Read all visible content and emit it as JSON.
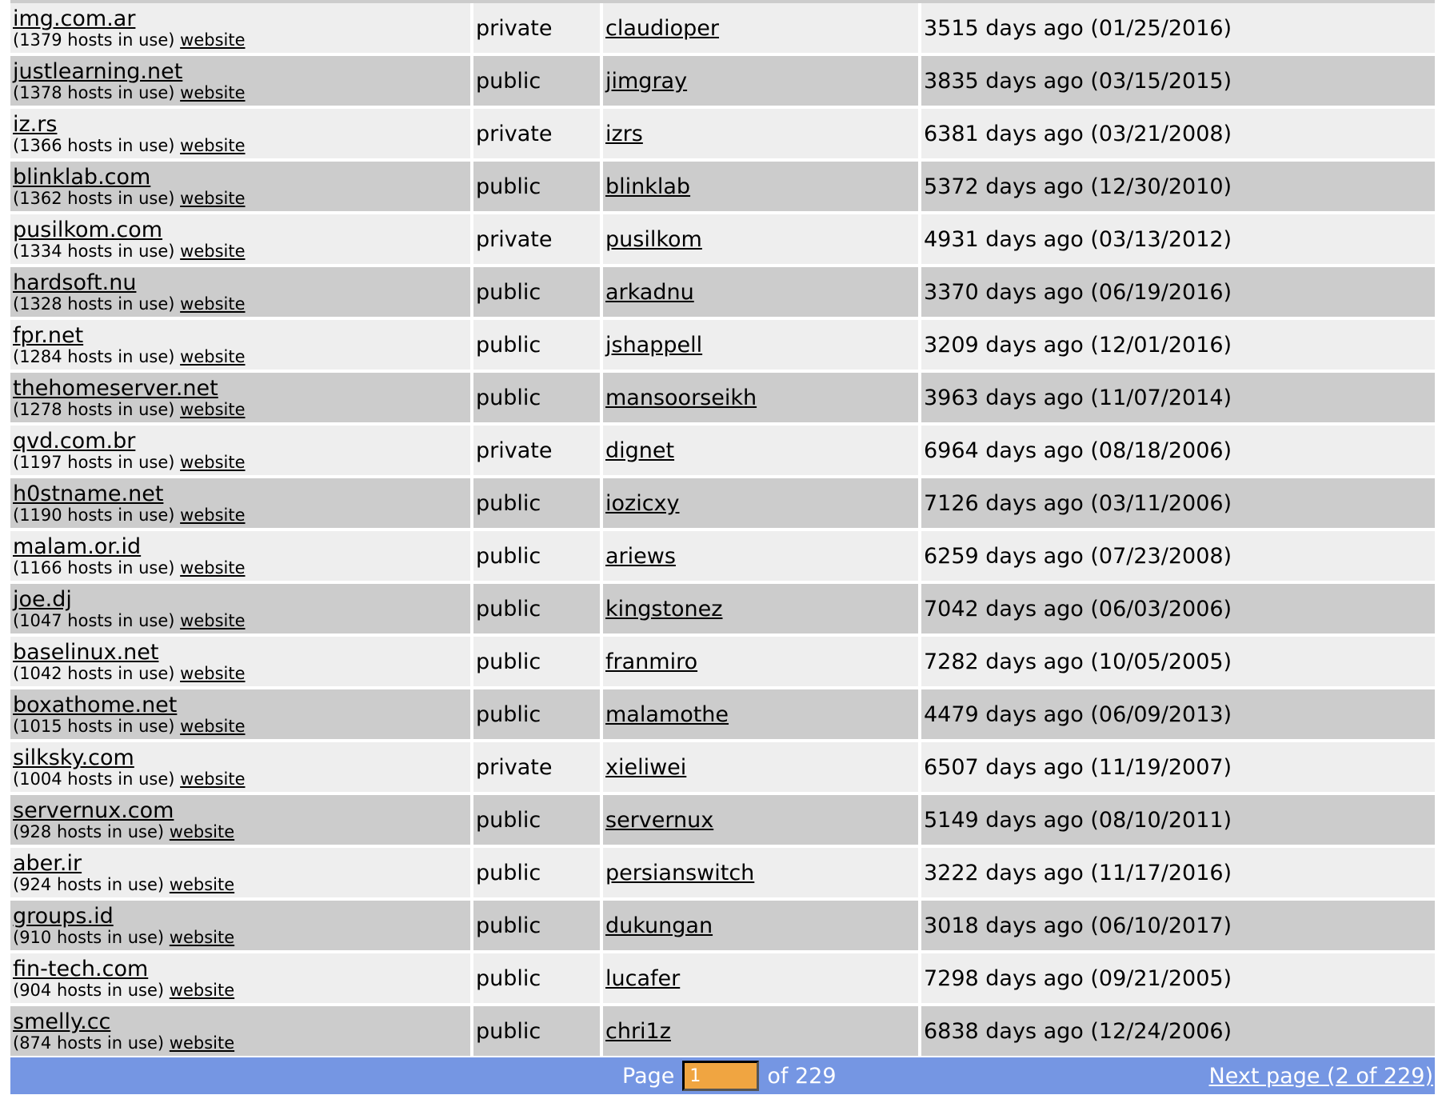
{
  "rows": [
    {
      "domain": "img.com.ar",
      "hosts": "(1379 hosts in use)",
      "website": "website",
      "status": "private",
      "owner": "claudioper",
      "age": "3515 days ago (01/25/2016)"
    },
    {
      "domain": "justlearning.net",
      "hosts": "(1378 hosts in use)",
      "website": "website",
      "status": "public",
      "owner": "jimgray",
      "age": "3835 days ago (03/15/2015)"
    },
    {
      "domain": "iz.rs",
      "hosts": "(1366 hosts in use)",
      "website": "website",
      "status": "private",
      "owner": "izrs",
      "age": "6381 days ago (03/21/2008)"
    },
    {
      "domain": "blinklab.com",
      "hosts": "(1362 hosts in use)",
      "website": "website",
      "status": "public",
      "owner": "blinklab",
      "age": "5372 days ago (12/30/2010)"
    },
    {
      "domain": "pusilkom.com",
      "hosts": "(1334 hosts in use)",
      "website": "website",
      "status": "private",
      "owner": "pusilkom",
      "age": "4931 days ago (03/13/2012)"
    },
    {
      "domain": "hardsoft.nu",
      "hosts": "(1328 hosts in use)",
      "website": "website",
      "status": "public",
      "owner": "arkadnu",
      "age": "3370 days ago (06/19/2016)"
    },
    {
      "domain": "fpr.net",
      "hosts": "(1284 hosts in use)",
      "website": "website",
      "status": "public",
      "owner": "jshappell",
      "age": "3209 days ago (12/01/2016)"
    },
    {
      "domain": "thehomeserver.net",
      "hosts": "(1278 hosts in use)",
      "website": "website",
      "status": "public",
      "owner": "mansoorseikh",
      "age": "3963 days ago (11/07/2014)"
    },
    {
      "domain": "qvd.com.br",
      "hosts": "(1197 hosts in use)",
      "website": "website",
      "status": "private",
      "owner": "dignet",
      "age": "6964 days ago (08/18/2006)"
    },
    {
      "domain": "h0stname.net",
      "hosts": "(1190 hosts in use)",
      "website": "website",
      "status": "public",
      "owner": "iozicxy",
      "age": "7126 days ago (03/11/2006)"
    },
    {
      "domain": "malam.or.id",
      "hosts": "(1166 hosts in use)",
      "website": "website",
      "status": "public",
      "owner": "ariews",
      "age": "6259 days ago (07/23/2008)"
    },
    {
      "domain": "joe.dj",
      "hosts": "(1047 hosts in use)",
      "website": "website",
      "status": "public",
      "owner": "kingstonez",
      "age": "7042 days ago (06/03/2006)"
    },
    {
      "domain": "baselinux.net",
      "hosts": "(1042 hosts in use)",
      "website": "website",
      "status": "public",
      "owner": "franmiro",
      "age": "7282 days ago (10/05/2005)"
    },
    {
      "domain": "boxathome.net",
      "hosts": "(1015 hosts in use)",
      "website": "website",
      "status": "public",
      "owner": "malamothe",
      "age": "4479 days ago (06/09/2013)"
    },
    {
      "domain": "silksky.com",
      "hosts": "(1004 hosts in use)",
      "website": "website",
      "status": "private",
      "owner": "xieliwei",
      "age": "6507 days ago (11/19/2007)"
    },
    {
      "domain": "servernux.com",
      "hosts": "(928 hosts in use)",
      "website": "website",
      "status": "public",
      "owner": "servernux",
      "age": "5149 days ago (08/10/2011)"
    },
    {
      "domain": "aber.ir",
      "hosts": "(924 hosts in use)",
      "website": "website",
      "status": "public",
      "owner": "persianswitch",
      "age": "3222 days ago (11/17/2016)"
    },
    {
      "domain": "groups.id",
      "hosts": "(910 hosts in use)",
      "website": "website",
      "status": "public",
      "owner": "dukungan",
      "age": "3018 days ago (06/10/2017)"
    },
    {
      "domain": "fin-tech.com",
      "hosts": "(904 hosts in use)",
      "website": "website",
      "status": "public",
      "owner": "lucafer",
      "age": "7298 days ago (09/21/2005)"
    },
    {
      "domain": "smelly.cc",
      "hosts": "(874 hosts in use)",
      "website": "website",
      "status": "public",
      "owner": "chri1z",
      "age": "6838 days ago (12/24/2006)"
    }
  ],
  "pager": {
    "page_label": "Page",
    "current_page": "1",
    "of_label": "of 229",
    "next_label": "Next page (2 of 229)"
  },
  "colors": {
    "row_odd": "#eeeeee",
    "row_even": "#cccccc",
    "pager_bg": "#7596e3",
    "page_input_bg": "#f0a541"
  }
}
